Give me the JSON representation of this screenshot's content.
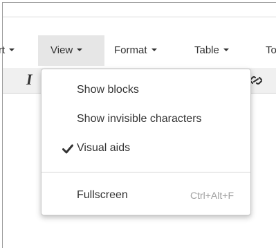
{
  "menubar": {
    "items": [
      {
        "label": "rt"
      },
      {
        "label": "View"
      },
      {
        "label": "Format"
      },
      {
        "label": "Table"
      },
      {
        "label": "To"
      }
    ]
  },
  "toolbar": {
    "italic_glyph": "I",
    "unlink_icon": "unlink-icon"
  },
  "view_menu": {
    "items": [
      {
        "label": "Show blocks",
        "checked": false
      },
      {
        "label": "Show invisible characters",
        "checked": false
      },
      {
        "label": "Visual aids",
        "checked": true
      },
      {
        "label": "Fullscreen",
        "shortcut": "Ctrl+Alt+F"
      }
    ]
  },
  "colors": {
    "text": "#333333",
    "active_menu_bg": "#e6e6e6",
    "toolbar_bg": "#f0f0f0",
    "shortcut": "#a0a0a0"
  }
}
